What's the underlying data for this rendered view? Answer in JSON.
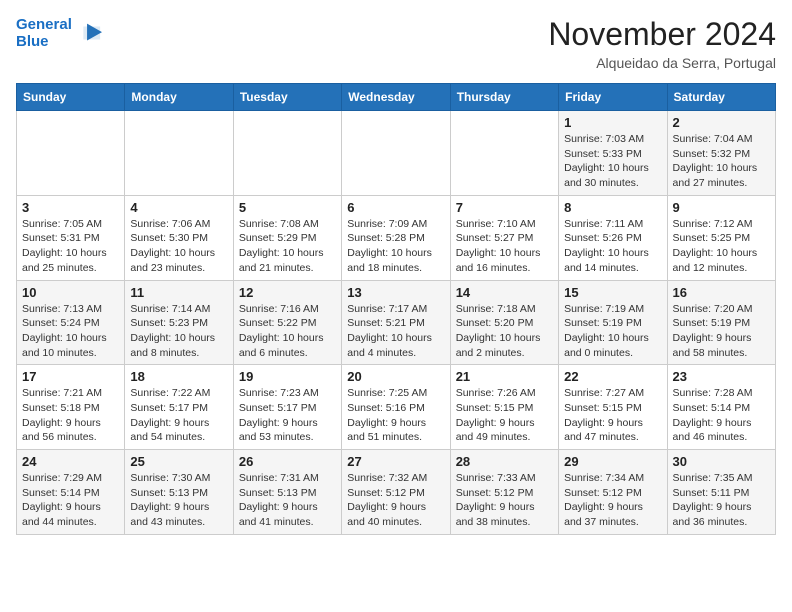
{
  "logo": {
    "line1": "General",
    "line2": "Blue"
  },
  "title": "November 2024",
  "subtitle": "Alqueidao da Serra, Portugal",
  "weekdays": [
    "Sunday",
    "Monday",
    "Tuesday",
    "Wednesday",
    "Thursday",
    "Friday",
    "Saturday"
  ],
  "weeks": [
    [
      {
        "day": "",
        "info": ""
      },
      {
        "day": "",
        "info": ""
      },
      {
        "day": "",
        "info": ""
      },
      {
        "day": "",
        "info": ""
      },
      {
        "day": "",
        "info": ""
      },
      {
        "day": "1",
        "info": "Sunrise: 7:03 AM\nSunset: 5:33 PM\nDaylight: 10 hours\nand 30 minutes."
      },
      {
        "day": "2",
        "info": "Sunrise: 7:04 AM\nSunset: 5:32 PM\nDaylight: 10 hours\nand 27 minutes."
      }
    ],
    [
      {
        "day": "3",
        "info": "Sunrise: 7:05 AM\nSunset: 5:31 PM\nDaylight: 10 hours\nand 25 minutes."
      },
      {
        "day": "4",
        "info": "Sunrise: 7:06 AM\nSunset: 5:30 PM\nDaylight: 10 hours\nand 23 minutes."
      },
      {
        "day": "5",
        "info": "Sunrise: 7:08 AM\nSunset: 5:29 PM\nDaylight: 10 hours\nand 21 minutes."
      },
      {
        "day": "6",
        "info": "Sunrise: 7:09 AM\nSunset: 5:28 PM\nDaylight: 10 hours\nand 18 minutes."
      },
      {
        "day": "7",
        "info": "Sunrise: 7:10 AM\nSunset: 5:27 PM\nDaylight: 10 hours\nand 16 minutes."
      },
      {
        "day": "8",
        "info": "Sunrise: 7:11 AM\nSunset: 5:26 PM\nDaylight: 10 hours\nand 14 minutes."
      },
      {
        "day": "9",
        "info": "Sunrise: 7:12 AM\nSunset: 5:25 PM\nDaylight: 10 hours\nand 12 minutes."
      }
    ],
    [
      {
        "day": "10",
        "info": "Sunrise: 7:13 AM\nSunset: 5:24 PM\nDaylight: 10 hours\nand 10 minutes."
      },
      {
        "day": "11",
        "info": "Sunrise: 7:14 AM\nSunset: 5:23 PM\nDaylight: 10 hours\nand 8 minutes."
      },
      {
        "day": "12",
        "info": "Sunrise: 7:16 AM\nSunset: 5:22 PM\nDaylight: 10 hours\nand 6 minutes."
      },
      {
        "day": "13",
        "info": "Sunrise: 7:17 AM\nSunset: 5:21 PM\nDaylight: 10 hours\nand 4 minutes."
      },
      {
        "day": "14",
        "info": "Sunrise: 7:18 AM\nSunset: 5:20 PM\nDaylight: 10 hours\nand 2 minutes."
      },
      {
        "day": "15",
        "info": "Sunrise: 7:19 AM\nSunset: 5:19 PM\nDaylight: 10 hours\nand 0 minutes."
      },
      {
        "day": "16",
        "info": "Sunrise: 7:20 AM\nSunset: 5:19 PM\nDaylight: 9 hours\nand 58 minutes."
      }
    ],
    [
      {
        "day": "17",
        "info": "Sunrise: 7:21 AM\nSunset: 5:18 PM\nDaylight: 9 hours\nand 56 minutes."
      },
      {
        "day": "18",
        "info": "Sunrise: 7:22 AM\nSunset: 5:17 PM\nDaylight: 9 hours\nand 54 minutes."
      },
      {
        "day": "19",
        "info": "Sunrise: 7:23 AM\nSunset: 5:17 PM\nDaylight: 9 hours\nand 53 minutes."
      },
      {
        "day": "20",
        "info": "Sunrise: 7:25 AM\nSunset: 5:16 PM\nDaylight: 9 hours\nand 51 minutes."
      },
      {
        "day": "21",
        "info": "Sunrise: 7:26 AM\nSunset: 5:15 PM\nDaylight: 9 hours\nand 49 minutes."
      },
      {
        "day": "22",
        "info": "Sunrise: 7:27 AM\nSunset: 5:15 PM\nDaylight: 9 hours\nand 47 minutes."
      },
      {
        "day": "23",
        "info": "Sunrise: 7:28 AM\nSunset: 5:14 PM\nDaylight: 9 hours\nand 46 minutes."
      }
    ],
    [
      {
        "day": "24",
        "info": "Sunrise: 7:29 AM\nSunset: 5:14 PM\nDaylight: 9 hours\nand 44 minutes."
      },
      {
        "day": "25",
        "info": "Sunrise: 7:30 AM\nSunset: 5:13 PM\nDaylight: 9 hours\nand 43 minutes."
      },
      {
        "day": "26",
        "info": "Sunrise: 7:31 AM\nSunset: 5:13 PM\nDaylight: 9 hours\nand 41 minutes."
      },
      {
        "day": "27",
        "info": "Sunrise: 7:32 AM\nSunset: 5:12 PM\nDaylight: 9 hours\nand 40 minutes."
      },
      {
        "day": "28",
        "info": "Sunrise: 7:33 AM\nSunset: 5:12 PM\nDaylight: 9 hours\nand 38 minutes."
      },
      {
        "day": "29",
        "info": "Sunrise: 7:34 AM\nSunset: 5:12 PM\nDaylight: 9 hours\nand 37 minutes."
      },
      {
        "day": "30",
        "info": "Sunrise: 7:35 AM\nSunset: 5:11 PM\nDaylight: 9 hours\nand 36 minutes."
      }
    ]
  ]
}
